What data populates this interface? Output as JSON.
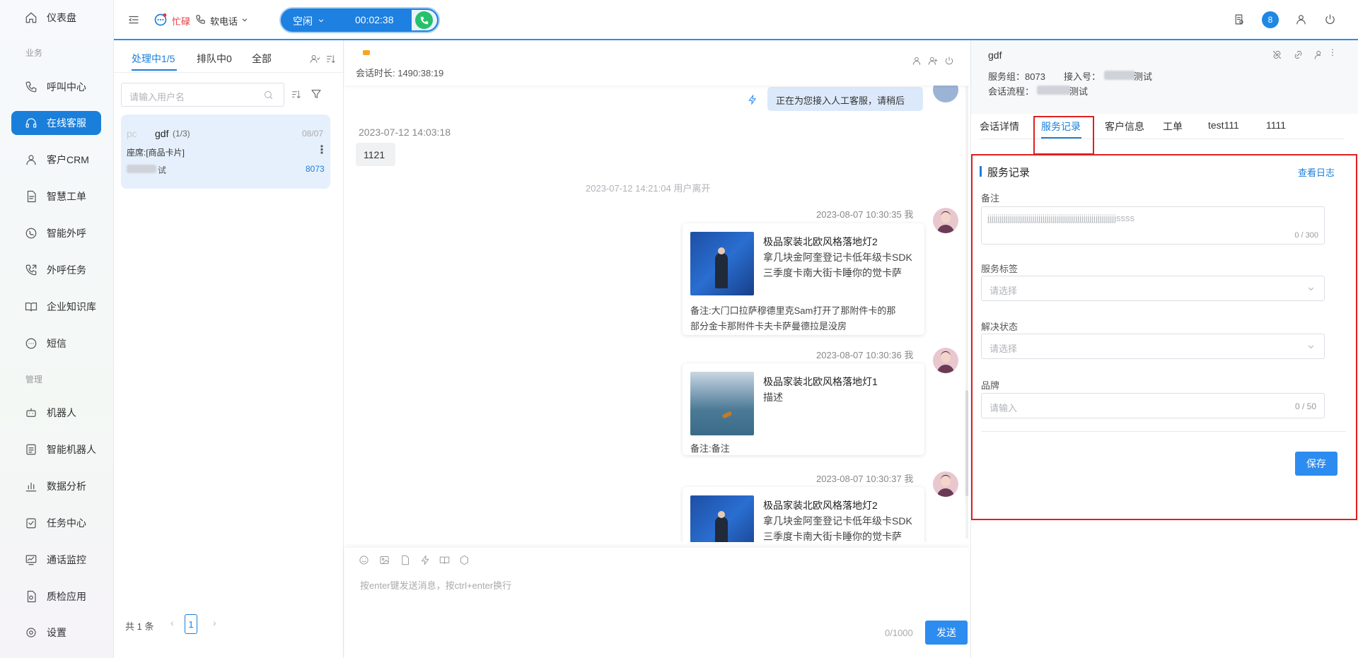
{
  "sidebar": {
    "items": [
      {
        "label": "仪表盘",
        "icon": "home-icon"
      },
      {
        "label": "呼叫中心",
        "icon": "phone-icon"
      },
      {
        "label": "在线客服",
        "icon": "headset-icon"
      },
      {
        "label": "客户CRM",
        "icon": "user-icon"
      },
      {
        "label": "智慧工单",
        "icon": "document-icon"
      },
      {
        "label": "智能外呼",
        "icon": "whatsapp-phone-icon"
      },
      {
        "label": "外呼任务",
        "icon": "phone-forward-icon"
      },
      {
        "label": "企业知识库",
        "icon": "book-icon"
      },
      {
        "label": "短信",
        "icon": "sms-icon"
      },
      {
        "label": "机器人",
        "icon": "robot-icon"
      },
      {
        "label": "智能机器人",
        "icon": "smart-robot-icon"
      },
      {
        "label": "数据分析",
        "icon": "bar-chart-icon"
      },
      {
        "label": "任务中心",
        "icon": "task-icon"
      },
      {
        "label": "通话监控",
        "icon": "monitor-icon"
      },
      {
        "label": "质检应用",
        "icon": "quality-icon"
      },
      {
        "label": "设置",
        "icon": "gear-icon"
      }
    ],
    "section_business": "业务",
    "section_manage": "管理"
  },
  "header": {
    "status_busy": "忙碌",
    "softphone": "软电话",
    "call_status": "空闲",
    "call_timer": "00:02:38",
    "badge_count": "8"
  },
  "list": {
    "tabs": [
      "处理中1/5",
      "排队中0",
      "全部"
    ],
    "search_placeholder": "请输入用户名",
    "conversation": {
      "name": "gdf",
      "count": "(1/3)",
      "date": "08/07",
      "preview": "座席:[商品卡片]",
      "sub_suffix": "试",
      "group": "8073",
      "avatar_text": "pc"
    },
    "pagination": {
      "total": "共 1 条",
      "page": "1"
    }
  },
  "chat": {
    "duration": "会话时长: 1490:38:19",
    "system_msg": "正在为您接入人工客服，请稍后",
    "msg1_time": "2023-07-12 14:03:18",
    "msg1_text": "1121",
    "leave_notice": "2023-07-12 14:21:04 用户离开",
    "cards": [
      {
        "time": "2023-08-07 10:30:35 我",
        "title": "极品家装北欧风格落地灯2",
        "lines": [
          "拿几块金阿奎登记卡低年级卡SDK",
          "三季度卡南大街卡睡你的觉卡萨"
        ],
        "note": [
          "备注:大门口拉萨穆德里克Sam打开了那附件卡的那",
          "部分金卡那附件卡夫卡萨曼德拉是没房"
        ]
      },
      {
        "time": "2023-08-07 10:30:36 我",
        "title": "极品家装北欧风格落地灯1",
        "lines": [
          "描述"
        ],
        "note": [
          "备注:备注"
        ]
      },
      {
        "time": "2023-08-07 10:30:37 我",
        "title": "极品家装北欧风格落地灯2",
        "lines": [
          "拿几块金阿奎登记卡低年级卡SDK",
          "三季度卡南大街卡睡你的觉卡萨"
        ],
        "note": []
      }
    ],
    "input_placeholder": "按enter键发送消息，按ctrl+enter换行",
    "counter": "0/1000",
    "send_label": "发送"
  },
  "right": {
    "name": "gdf",
    "service_group": "服务组：8073",
    "access_no": "接入号：",
    "access_suffix": "测试",
    "flow": "会话流程：",
    "flow_suffix": "测试",
    "tabs": [
      "会话详情",
      "服务记录",
      "客户信息",
      "工单",
      "test111",
      "1111"
    ],
    "section_title": "服务记录",
    "view_log": "查看日志",
    "remark_label": "备注",
    "remark_value": "jjjjjjjjjjjjjjjjjjjjjjjjjjjjjjjjjjjjjjjjjjjjjjjjjjjjjjjjjjjjjjjssss",
    "remark_counter": "0 / 300",
    "tag_label": "服务标签",
    "tag_placeholder": "请选择",
    "status_label": "解决状态",
    "status_placeholder": "请选择",
    "brand_label": "品牌",
    "brand_placeholder": "请输入",
    "brand_counter": "0 / 50",
    "save_label": "保存"
  },
  "colors": {
    "accent": "#1a7fdb",
    "highlight_border": "#e02020",
    "busy": "#e8383d"
  }
}
